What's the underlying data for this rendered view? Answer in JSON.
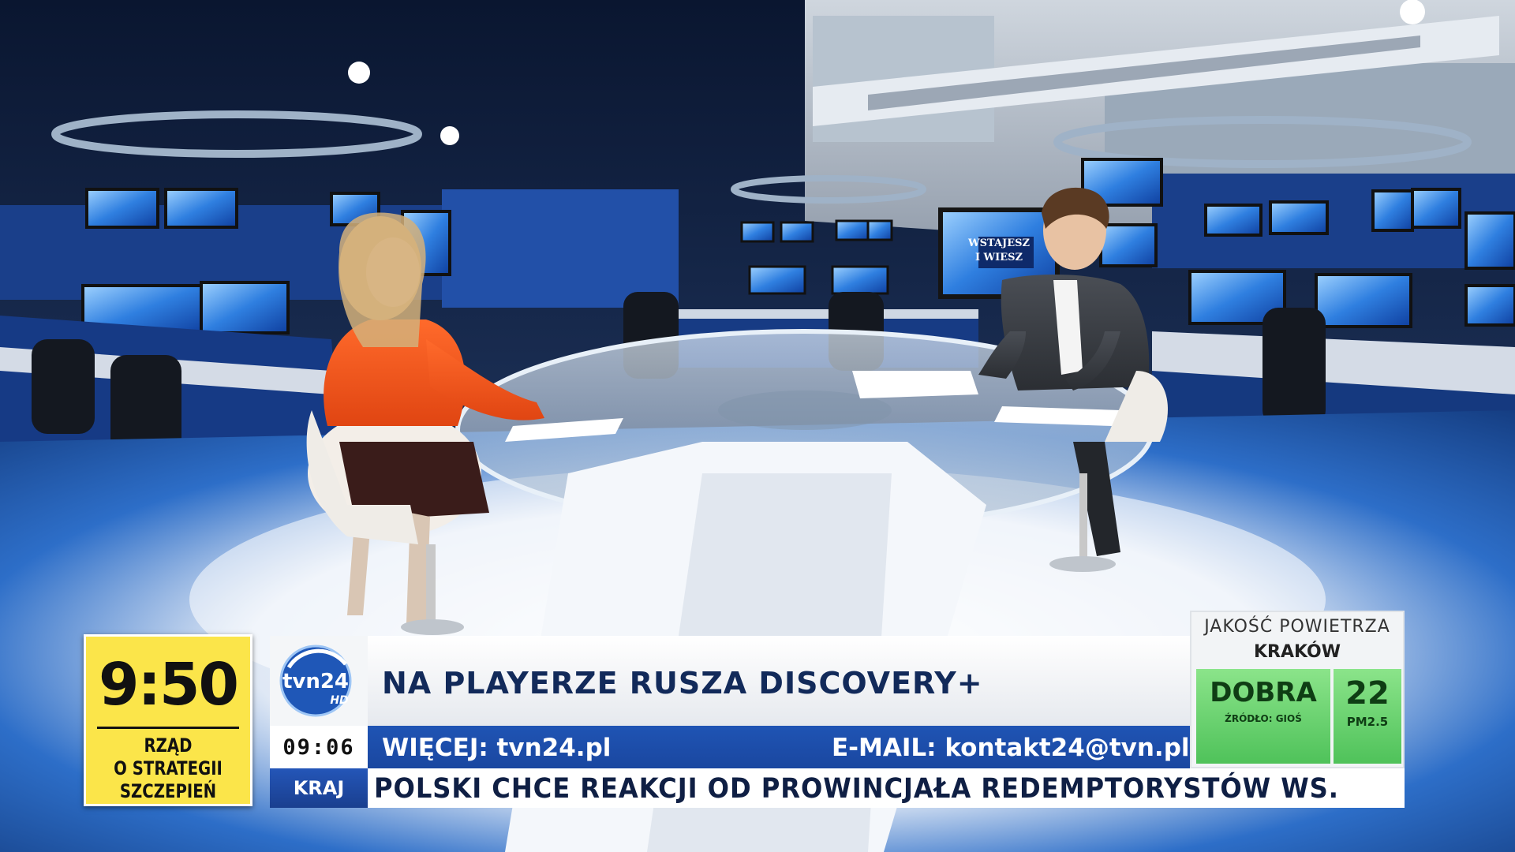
{
  "clock": {
    "time": "9:50",
    "caption_lines": [
      "RZĄD",
      "O STRATEGII",
      "SZCZEPIEŃ"
    ]
  },
  "channel": {
    "logo_name": "tvn24",
    "logo_badge": "HD"
  },
  "headline": {
    "text": "NA PLAYERZE RUSZA DISCOVERY+"
  },
  "info_bar": {
    "clock": "09:06",
    "more": "WIĘCEJ: tvn24.pl",
    "email": "E-MAIL: kontakt24@tvn.pl"
  },
  "ticker": {
    "category": "KRAJ",
    "text": "POLSKI CHCE REAKCJI OD PROWINCJAŁA REDEMPTORYSTÓW WS."
  },
  "air_quality": {
    "title": "JAKOŚĆ POWIETRZA",
    "city": "KRAKÓW",
    "rating": "DOBRA",
    "source": "ŹRÓDŁO: GIOŚ",
    "value": "22",
    "unit": "PM2.5"
  },
  "studio_screens": {
    "show_name_lines": [
      "WSTAJESZ",
      "I WIESZ"
    ]
  },
  "colors": {
    "ticker_blue": "#1f54b4",
    "clock_yellow": "#fbe54a",
    "air_green": "#5cc866",
    "studio_blue": "#1b4bb0"
  }
}
